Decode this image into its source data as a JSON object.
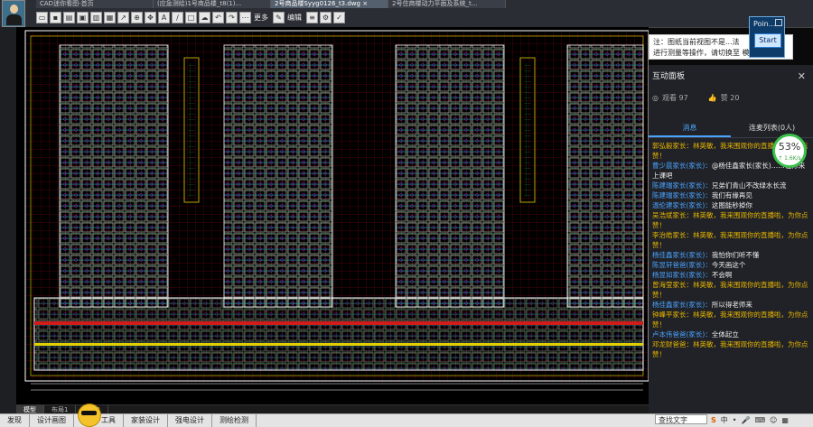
{
  "tabs": [
    {
      "label": "CAD迷你看图-首页"
    },
    {
      "label": "(应急测绘)1号商品楼_t8(1)..."
    },
    {
      "label": "2号商品楼Syyg0126_t3.dwg ×"
    },
    {
      "label": "2号住商楼动力平面及系统_t..."
    }
  ],
  "toolbar": {
    "more_label": "更多",
    "edit_label": "编辑"
  },
  "point_panel": {
    "title": "Poin...",
    "start_label": "Start"
  },
  "notice": {
    "line1": "注：图纸当前视图不是...法",
    "line2": "进行测量等操作，请切换至 模型图"
  },
  "panel": {
    "title": "互动面板",
    "viewers_label": "观看 97",
    "likes_label": "赞 20",
    "tab_messages": "消息",
    "tab_mic": "连麦列表(0人)"
  },
  "messages": [
    {
      "user": "郭弘毅家长：",
      "text": "林英敏，我来围观你的直播啦，为你点赞！",
      "highlight": true
    },
    {
      "user": "曹少晨家长(家长)：",
      "text": "@杨佳鑫家长(家长)……让你来上课吧",
      "highlight": false
    },
    {
      "user": "陈建瑞家长(家长)：",
      "text": "兄弟们青山不改绿水长流",
      "highlight": false
    },
    {
      "user": "陈建瑞家长(家长)：",
      "text": "我们有缘再见",
      "highlight": false
    },
    {
      "user": "温伦建家长(家长)：",
      "text": "这图能秒掉你",
      "highlight": false
    },
    {
      "user": "吴浩斌家长：",
      "text": "林英敏，我来围观你的直播啦，为你点赞！",
      "highlight": true
    },
    {
      "user": "李治皓家长：",
      "text": "林英敏，我来围观你的直播啦，为你点赞！",
      "highlight": true
    },
    {
      "user": "杨佳鑫家长(家长)：",
      "text": "我怕你们听不懂",
      "highlight": false
    },
    {
      "user": "陈昱轩爸爸(家长)：",
      "text": "今天画这个",
      "highlight": false
    },
    {
      "user": "杨昱如家长(家长)：",
      "text": "不会啊",
      "highlight": false
    },
    {
      "user": "曾海莹家长：",
      "text": "林英敏，我来围观你的直播啦，为你点赞！",
      "highlight": true
    },
    {
      "user": "杨佳鑫家长(家长)：",
      "text": "所以得老师来",
      "highlight": false
    },
    {
      "user": "钟峰平家长：",
      "text": "林英敏，我来围观你的直播啦，为你点赞！",
      "highlight": true
    },
    {
      "user": "卢本伟爸爸(家长)：",
      "text": "全体起立",
      "highlight": false
    },
    {
      "user": "邓龙财爸爸：",
      "text": "林英敏，我来围观你的直播啦，为你点赞！",
      "highlight": true
    }
  ],
  "gauge": {
    "percent": "53%",
    "speed": "↑ 1.6K/s"
  },
  "layout_tabs": [
    {
      "label": "模型"
    },
    {
      "label": "布局1"
    },
    {
      "label": "布局2"
    }
  ],
  "bottom_bar": [
    {
      "label": "发现"
    },
    {
      "label": "设计画图"
    },
    {
      "label": "工具"
    },
    {
      "label": "家装设计"
    },
    {
      "label": "强电设计"
    },
    {
      "label": "测绘检测"
    }
  ],
  "search": {
    "placeholder": "查找文字"
  },
  "ime": {
    "label": "中"
  }
}
